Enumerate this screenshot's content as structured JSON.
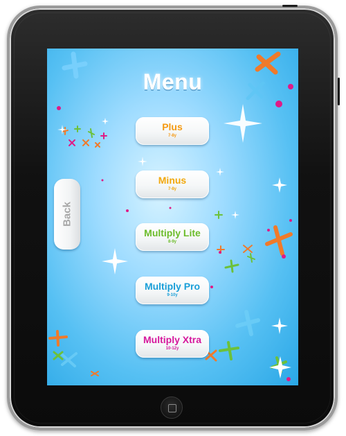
{
  "title": "Menu",
  "back_label": "Back",
  "menu_items": [
    {
      "label": "Plus",
      "age": "7-8y",
      "color": "#f59a12"
    },
    {
      "label": "Minus",
      "age": "7-8y",
      "color": "#f2a80c"
    },
    {
      "label": "Multiply Lite",
      "age": "8-9y",
      "color": "#6cbc2a"
    },
    {
      "label": "Multiply Pro",
      "age": "9-10y",
      "color": "#1a9fd8"
    },
    {
      "label": "Multiply Xtra",
      "age": "10-12y",
      "color": "#d6179c"
    }
  ],
  "colors": {
    "background_center": "#d7f3ff",
    "background_edge": "#2aa7e6",
    "sparkle_orange": "#f07a2a",
    "sparkle_pink": "#e01a86",
    "sparkle_green": "#6cc13a"
  }
}
